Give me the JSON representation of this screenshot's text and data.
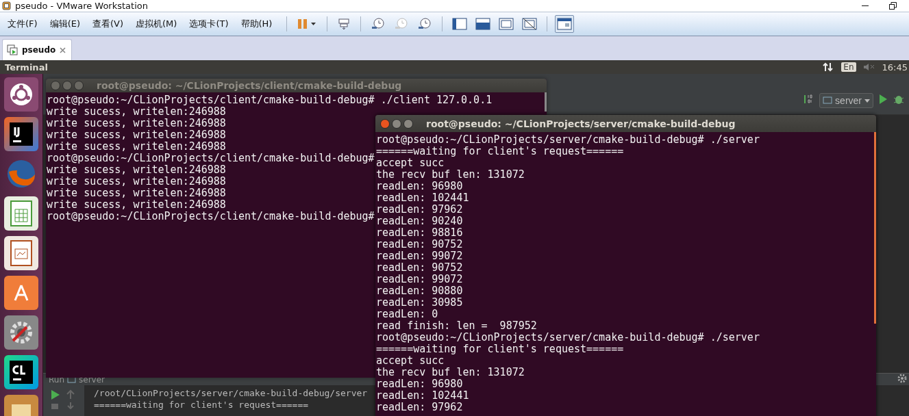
{
  "window": {
    "title": "pseudo - VMware Workstation"
  },
  "menu": [
    "文件(F)",
    "编辑(E)",
    "查看(V)",
    "虚拟机(M)",
    "选项卡(T)",
    "帮助(H)"
  ],
  "tabs": [
    {
      "label": "pseudo",
      "selected": true
    }
  ],
  "top_panel": {
    "app_name": "Terminal",
    "keyboard": "En",
    "time": "16:45"
  },
  "ide": {
    "run_config": "server",
    "run_panel": {
      "title": "Run",
      "config": "server",
      "lines": [
        "/root/CLionProjects/server/cmake-build-debug/server",
        "======waiting for client's request======"
      ]
    }
  },
  "terminals": [
    {
      "title": "root@pseudo: ~/CLionProjects/client/cmake-build-debug",
      "active": false,
      "lines": [
        "root@pseudo:~/CLionProjects/client/cmake-build-debug# ./client 127.0.0.1",
        "write sucess, writelen:246988",
        "write sucess, writelen:246988",
        "write sucess, writelen:246988",
        "write sucess, writelen:246988",
        "root@pseudo:~/CLionProjects/client/cmake-build-debug#",
        "write sucess, writelen:246988",
        "write sucess, writelen:246988",
        "write sucess, writelen:246988",
        "write sucess, writelen:246988",
        "root@pseudo:~/CLionProjects/client/cmake-build-debug#"
      ]
    },
    {
      "title": "root@pseudo: ~/CLionProjects/server/cmake-build-debug",
      "active": true,
      "lines": [
        "root@pseudo:~/CLionProjects/server/cmake-build-debug# ./server",
        "======waiting for client's request======",
        "accept succ",
        "the recv buf len: 131072",
        "readLen: 96980",
        "readLen: 102441",
        "readLen: 97962",
        "readLen: 90240",
        "readLen: 98816",
        "readLen: 90752",
        "readLen: 99072",
        "readLen: 90752",
        "readLen: 99072",
        "readLen: 90880",
        "readLen: 30985",
        "readLen: 0",
        "read finish: len =  987952",
        "root@pseudo:~/CLionProjects/server/cmake-build-debug# ./server",
        "======waiting for client's request======",
        "accept succ",
        "the recv buf len: 131072",
        "readLen: 96980",
        "readLen: 102441",
        "readLen: 97962"
      ]
    }
  ]
}
